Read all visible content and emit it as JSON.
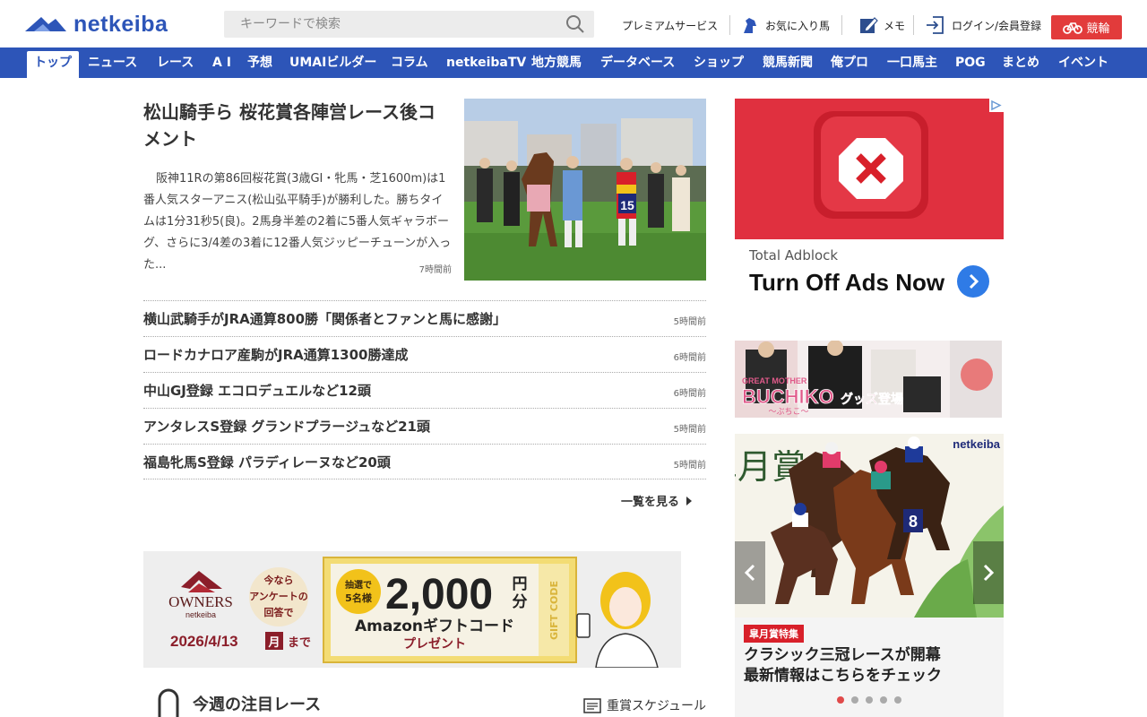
{
  "header": {
    "logo_text": "netkeiba",
    "search_placeholder": "キーワードで検索",
    "links": {
      "premium": "プレミアムサービス",
      "favorite": "お気に入り馬",
      "memo": "メモ",
      "login": "ログイン/会員登録",
      "keirin": "競輪"
    }
  },
  "nav": {
    "items": [
      "トップ",
      "ニュース",
      "レース",
      "A I",
      "予想",
      "UMAIビルダー",
      "コラム",
      "netkeibaTV",
      "地方競馬",
      "データベース",
      "ショップ",
      "競馬新聞",
      "俺プロ",
      "一口馬主",
      "POG",
      "まとめ",
      "イベント"
    ],
    "active_index": 0
  },
  "lead": {
    "title": "松山騎手ら 桜花賞各陣営レース後コメント",
    "body": "阪神11Rの第86回桜花賞(3歳GI・牝馬・芝1600m)は1番人気スターアニス(松山弘平騎手)が勝利した。勝ちタイムは1分31秒5(良)。2馬身半差の2着に5番人気ギャラボーグ、さらに3/4差の3着に12番人気ジッピーチューンが入った...",
    "time": "7時間前",
    "photo_number": "15"
  },
  "news": [
    {
      "title": "横山武騎手がJRA通算800勝「関係者とファンと馬に感謝」",
      "time": "5時間前"
    },
    {
      "title": "ロードカナロア産駒がJRA通算1300勝達成",
      "time": "6時間前"
    },
    {
      "title": "中山GJ登録 エコロデュエルなど12頭",
      "time": "6時間前"
    },
    {
      "title": "アンタレスS登録 グランドプラージュなど21頭",
      "time": "5時間前"
    },
    {
      "title": "福島牝馬S登録 パラディレーヌなど20頭",
      "time": "5時間前"
    }
  ],
  "more_label": "一覧を見る",
  "owners_banner": {
    "brand": "OWNERS",
    "sub": "netkeiba",
    "circle": [
      "今なら",
      "アンケートの",
      "回答で"
    ],
    "date": "2026/4/13",
    "weekday": "月",
    "until": "まで",
    "lottery": [
      "抽選で",
      "5名様"
    ],
    "amount": "2,000",
    "unit": [
      "円",
      "分"
    ],
    "gift": "Amazonギフトコード",
    "present": "プレゼント",
    "gift_code": "GIFT CODE"
  },
  "featured": {
    "title": "今週の注目レース",
    "schedule": "重賞スケジュール"
  },
  "ad": {
    "brand": "Total Adblock",
    "headline": "Turn Off Ads Now"
  },
  "buchiko": {
    "line1": "GREAT MOTHER",
    "line2": "BUCHIKO",
    "line3": "グッズ登場",
    "line4": "～ぶちこ～"
  },
  "satsuki": {
    "big_title": "皐月賞",
    "brand": "netkeiba",
    "number": "8",
    "tag": "皐月賞特集",
    "headline1": "クラシック三冠レースが開幕",
    "headline2": "最新情報はこちらをチェック",
    "slide_count": 5,
    "active_slide": 0
  },
  "colors": {
    "brand_blue": "#2d55b8",
    "keirin_red": "#e23b3b",
    "ad_red": "#e0303f"
  }
}
